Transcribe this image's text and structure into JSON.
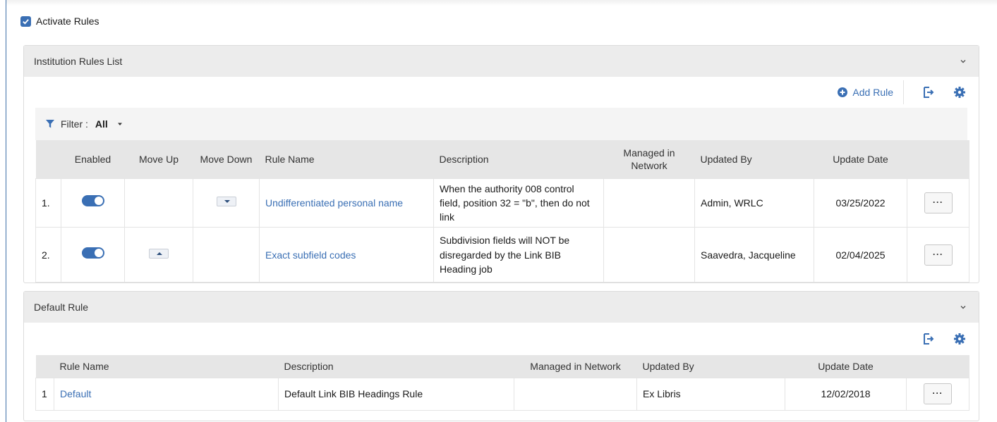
{
  "activate": {
    "label": "Activate Rules",
    "checked": true
  },
  "institution": {
    "title": "Institution Rules List",
    "add_rule_label": "Add Rule",
    "filter": {
      "label": "Filter :",
      "value": "All"
    },
    "columns": [
      "Enabled",
      "Move Up",
      "Move Down",
      "Rule Name",
      "Description",
      "Managed in Network",
      "Updated By",
      "Update Date"
    ],
    "rows": [
      {
        "index": "1.",
        "enabled": true,
        "rule_name": "Undifferentiated personal name",
        "description": "When the authority 008 control field, position 32 = \"b\", then do not link",
        "managed": "",
        "updated_by": "Admin, WRLC",
        "update_date": "03/25/2022",
        "more": "···"
      },
      {
        "index": "2.",
        "enabled": true,
        "rule_name": "Exact subfield codes",
        "description": "Subdivision fields will NOT be disregarded by the Link BIB Heading job",
        "managed": "",
        "updated_by": "Saavedra, Jacqueline",
        "update_date": "02/04/2025",
        "more": "···"
      }
    ]
  },
  "default": {
    "title": "Default Rule",
    "columns": [
      "Rule Name",
      "Description",
      "Managed in Network",
      "Updated By",
      "Update Date"
    ],
    "rows": [
      {
        "index": "1",
        "rule_name": "Default",
        "description": "Default Link BIB Headings Rule",
        "managed": "",
        "updated_by": "Ex Libris",
        "update_date": "12/02/2018",
        "more": "···"
      }
    ]
  },
  "colors": {
    "accent": "#3a6fb4",
    "header_bg": "#ececec",
    "table_head_bg": "#e6e6e6"
  },
  "icons": [
    "checkbox-checked-icon",
    "chevron-down-icon",
    "plus-circle-icon",
    "export-icon",
    "gear-icon",
    "filter-icon",
    "caret-down-icon"
  ]
}
